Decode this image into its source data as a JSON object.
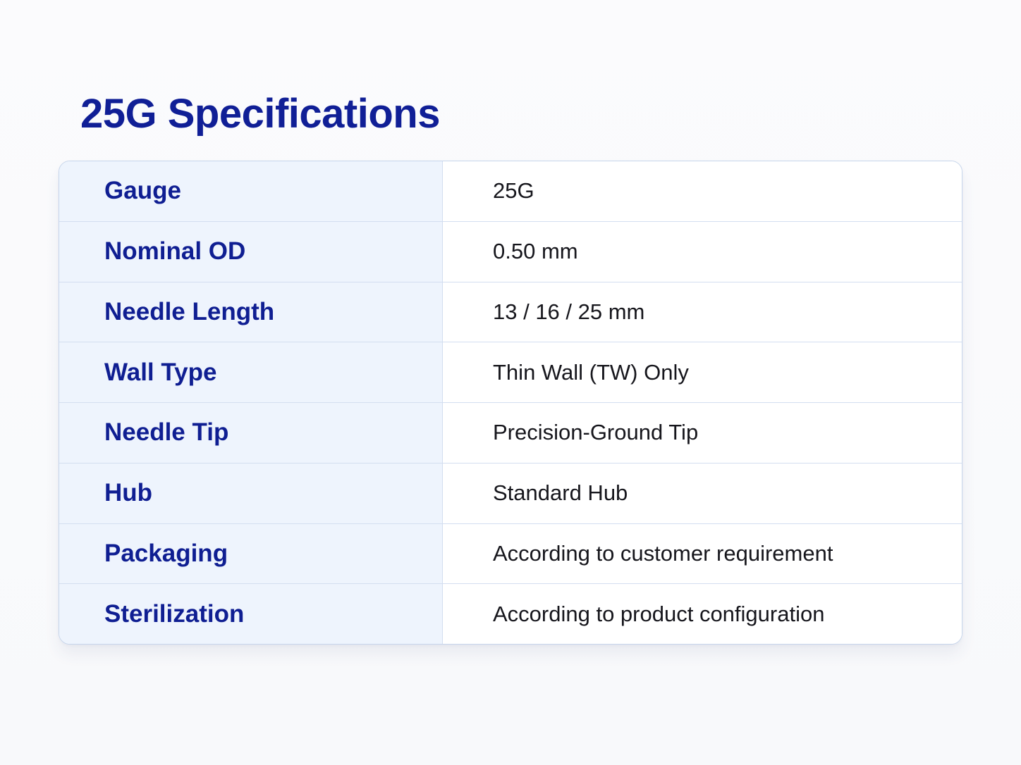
{
  "page": {
    "title": "25G Specifications"
  },
  "specs": [
    {
      "label": "Gauge",
      "value": "25G"
    },
    {
      "label": "Nominal OD",
      "value": "0.50 mm"
    },
    {
      "label": "Needle Length",
      "value": "13 / 16 / 25 mm"
    },
    {
      "label": "Wall Type",
      "value": "Thin Wall (TW) Only"
    },
    {
      "label": "Needle Tip",
      "value": "Precision-Ground Tip"
    },
    {
      "label": "Hub",
      "value": "Standard Hub"
    },
    {
      "label": "Packaging",
      "value": "According to customer requirement"
    },
    {
      "label": "Sterilization",
      "value": "According to product configuration"
    }
  ],
  "colors": {
    "title": "#101f96",
    "label": "#0f1e92",
    "value": "#16161c",
    "label_cell_background": "#eef4fd",
    "border": "#c7d6ec"
  }
}
